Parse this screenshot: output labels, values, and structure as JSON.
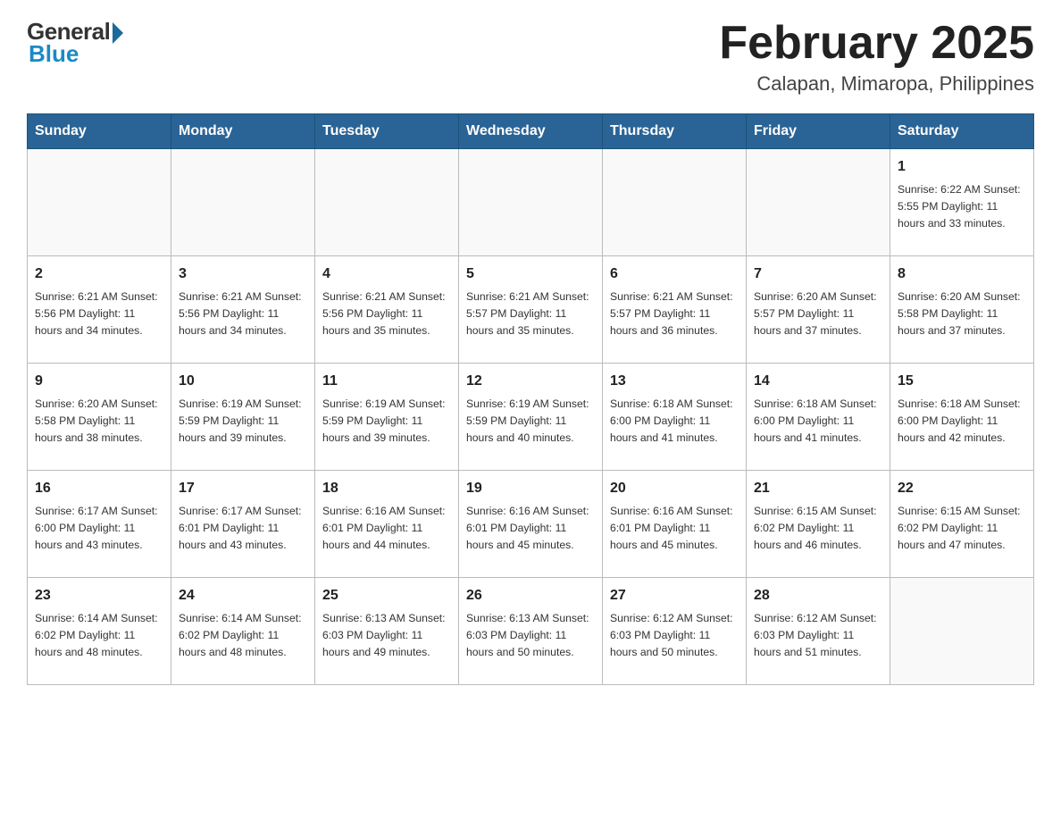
{
  "logo": {
    "general_text": "General",
    "blue_text": "Blue"
  },
  "header": {
    "title": "February 2025",
    "subtitle": "Calapan, Mimaropa, Philippines"
  },
  "weekdays": [
    "Sunday",
    "Monday",
    "Tuesday",
    "Wednesday",
    "Thursday",
    "Friday",
    "Saturday"
  ],
  "weeks": [
    [
      {
        "day": "",
        "info": ""
      },
      {
        "day": "",
        "info": ""
      },
      {
        "day": "",
        "info": ""
      },
      {
        "day": "",
        "info": ""
      },
      {
        "day": "",
        "info": ""
      },
      {
        "day": "",
        "info": ""
      },
      {
        "day": "1",
        "info": "Sunrise: 6:22 AM\nSunset: 5:55 PM\nDaylight: 11 hours\nand 33 minutes."
      }
    ],
    [
      {
        "day": "2",
        "info": "Sunrise: 6:21 AM\nSunset: 5:56 PM\nDaylight: 11 hours\nand 34 minutes."
      },
      {
        "day": "3",
        "info": "Sunrise: 6:21 AM\nSunset: 5:56 PM\nDaylight: 11 hours\nand 34 minutes."
      },
      {
        "day": "4",
        "info": "Sunrise: 6:21 AM\nSunset: 5:56 PM\nDaylight: 11 hours\nand 35 minutes."
      },
      {
        "day": "5",
        "info": "Sunrise: 6:21 AM\nSunset: 5:57 PM\nDaylight: 11 hours\nand 35 minutes."
      },
      {
        "day": "6",
        "info": "Sunrise: 6:21 AM\nSunset: 5:57 PM\nDaylight: 11 hours\nand 36 minutes."
      },
      {
        "day": "7",
        "info": "Sunrise: 6:20 AM\nSunset: 5:57 PM\nDaylight: 11 hours\nand 37 minutes."
      },
      {
        "day": "8",
        "info": "Sunrise: 6:20 AM\nSunset: 5:58 PM\nDaylight: 11 hours\nand 37 minutes."
      }
    ],
    [
      {
        "day": "9",
        "info": "Sunrise: 6:20 AM\nSunset: 5:58 PM\nDaylight: 11 hours\nand 38 minutes."
      },
      {
        "day": "10",
        "info": "Sunrise: 6:19 AM\nSunset: 5:59 PM\nDaylight: 11 hours\nand 39 minutes."
      },
      {
        "day": "11",
        "info": "Sunrise: 6:19 AM\nSunset: 5:59 PM\nDaylight: 11 hours\nand 39 minutes."
      },
      {
        "day": "12",
        "info": "Sunrise: 6:19 AM\nSunset: 5:59 PM\nDaylight: 11 hours\nand 40 minutes."
      },
      {
        "day": "13",
        "info": "Sunrise: 6:18 AM\nSunset: 6:00 PM\nDaylight: 11 hours\nand 41 minutes."
      },
      {
        "day": "14",
        "info": "Sunrise: 6:18 AM\nSunset: 6:00 PM\nDaylight: 11 hours\nand 41 minutes."
      },
      {
        "day": "15",
        "info": "Sunrise: 6:18 AM\nSunset: 6:00 PM\nDaylight: 11 hours\nand 42 minutes."
      }
    ],
    [
      {
        "day": "16",
        "info": "Sunrise: 6:17 AM\nSunset: 6:00 PM\nDaylight: 11 hours\nand 43 minutes."
      },
      {
        "day": "17",
        "info": "Sunrise: 6:17 AM\nSunset: 6:01 PM\nDaylight: 11 hours\nand 43 minutes."
      },
      {
        "day": "18",
        "info": "Sunrise: 6:16 AM\nSunset: 6:01 PM\nDaylight: 11 hours\nand 44 minutes."
      },
      {
        "day": "19",
        "info": "Sunrise: 6:16 AM\nSunset: 6:01 PM\nDaylight: 11 hours\nand 45 minutes."
      },
      {
        "day": "20",
        "info": "Sunrise: 6:16 AM\nSunset: 6:01 PM\nDaylight: 11 hours\nand 45 minutes."
      },
      {
        "day": "21",
        "info": "Sunrise: 6:15 AM\nSunset: 6:02 PM\nDaylight: 11 hours\nand 46 minutes."
      },
      {
        "day": "22",
        "info": "Sunrise: 6:15 AM\nSunset: 6:02 PM\nDaylight: 11 hours\nand 47 minutes."
      }
    ],
    [
      {
        "day": "23",
        "info": "Sunrise: 6:14 AM\nSunset: 6:02 PM\nDaylight: 11 hours\nand 48 minutes."
      },
      {
        "day": "24",
        "info": "Sunrise: 6:14 AM\nSunset: 6:02 PM\nDaylight: 11 hours\nand 48 minutes."
      },
      {
        "day": "25",
        "info": "Sunrise: 6:13 AM\nSunset: 6:03 PM\nDaylight: 11 hours\nand 49 minutes."
      },
      {
        "day": "26",
        "info": "Sunrise: 6:13 AM\nSunset: 6:03 PM\nDaylight: 11 hours\nand 50 minutes."
      },
      {
        "day": "27",
        "info": "Sunrise: 6:12 AM\nSunset: 6:03 PM\nDaylight: 11 hours\nand 50 minutes."
      },
      {
        "day": "28",
        "info": "Sunrise: 6:12 AM\nSunset: 6:03 PM\nDaylight: 11 hours\nand 51 minutes."
      },
      {
        "day": "",
        "info": ""
      }
    ]
  ]
}
